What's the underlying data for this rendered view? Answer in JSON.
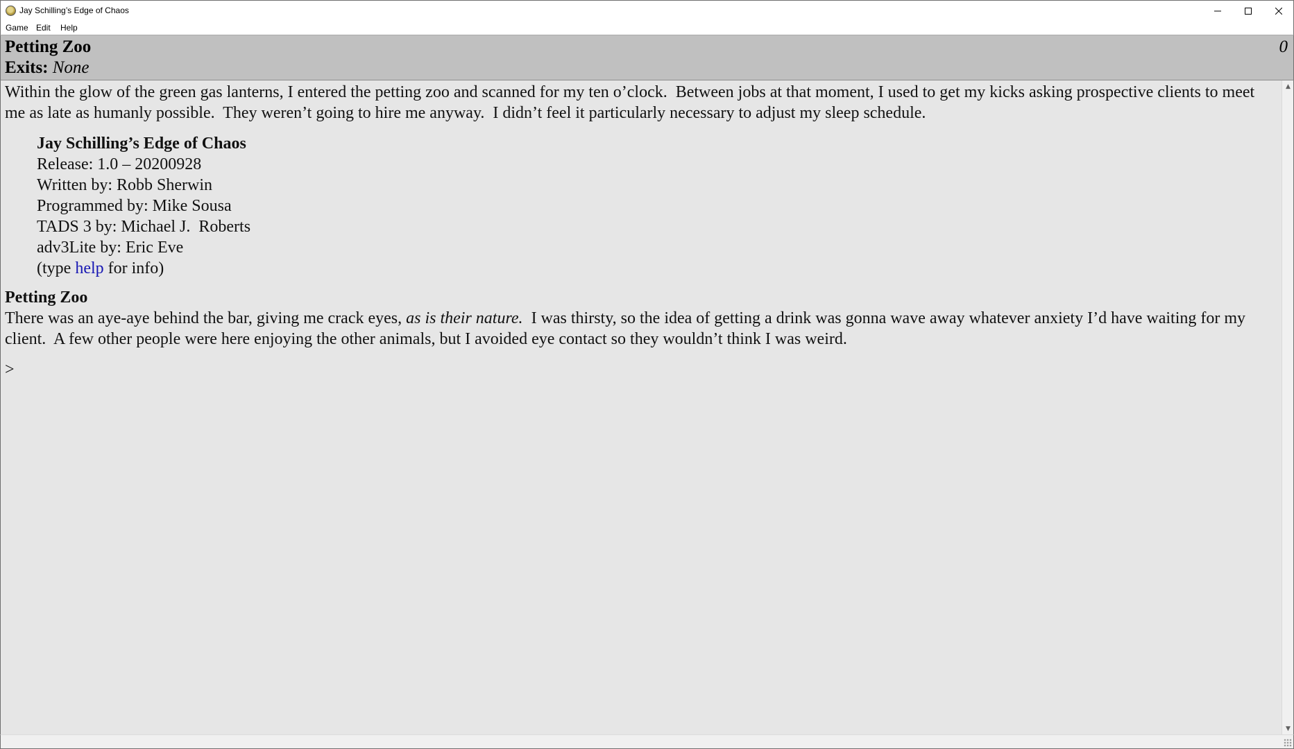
{
  "window": {
    "title": "Jay Schilling’s Edge of Chaos",
    "icon": "app-globe-icon",
    "controls": {
      "minimize": "–",
      "maximize": "□",
      "close": "✕"
    }
  },
  "menu": {
    "items": [
      "Game",
      "Edit",
      "Help"
    ]
  },
  "status": {
    "room": "Petting Zoo",
    "exits_label": "Exits:",
    "exits_value": "None",
    "score": "0"
  },
  "transcript": {
    "intro": "Within the glow of the green gas lanterns, I entered the petting zoo and scanned for my ten o’clock.  Between jobs at that moment, I used to get my kicks asking prospective clients to meet me as late as humanly possible.  They weren’t going to hire me anyway.  I didn’t feel it particularly necessary to adjust my sleep schedule.",
    "banner": {
      "title": "Jay Schilling’s Edge of Chaos",
      "release": "Release: 1.0 – 20200928",
      "written_by": "Written by: Robb Sherwin",
      "programmed_by": "Programmed by: Mike Sousa",
      "tads_by": "TADS 3 by: Michael J.  Roberts",
      "adv3lite_by": "adv3Lite by: Eric Eve",
      "help_prefix": "(type ",
      "help_link": "help",
      "help_suffix": " for info)"
    },
    "room_heading": "Petting Zoo",
    "room_desc_part1": "There was an aye-aye behind the bar, giving me crack eyes, ",
    "room_desc_italic": "as is their nature.",
    "room_desc_part2": "  I was thirsty, so the idea of getting a drink was gonna wave away whatever anxiety I’d have waiting for my client.  A few other people were here enjoying the other animals, but I avoided eye contact so they wouldn’t think I was weird.",
    "prompt": ">"
  },
  "colors": {
    "statusline_bg": "#c0c0c0",
    "transcript_bg": "#e6e6e6",
    "link": "#1717b3"
  }
}
